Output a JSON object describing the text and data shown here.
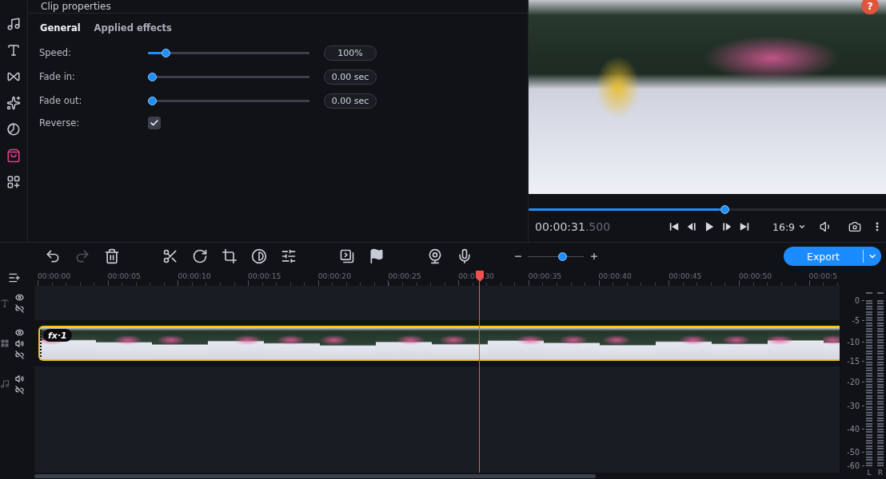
{
  "sidebar": {
    "items": [
      {
        "kind": "music",
        "selected": false
      },
      {
        "kind": "titles",
        "selected": false
      },
      {
        "kind": "transitions",
        "selected": false
      },
      {
        "kind": "effects",
        "selected": false
      },
      {
        "kind": "stickers",
        "selected": false
      },
      {
        "kind": "store",
        "selected": true
      },
      {
        "kind": "more",
        "selected": false
      }
    ]
  },
  "properties": {
    "title": "Clip properties",
    "tabs": [
      {
        "label": "General",
        "selected": true
      },
      {
        "label": "Applied effects",
        "selected": false
      }
    ],
    "rows": [
      {
        "kind": "slider",
        "label": "Speed:",
        "level": 0.09,
        "value": "100%"
      },
      {
        "kind": "slider",
        "label": "Fade in:",
        "level": 0,
        "value": "0.00 sec"
      },
      {
        "kind": "slider",
        "label": "Fade out:",
        "level": 0,
        "value": "0.00 sec"
      },
      {
        "kind": "checkbox",
        "label": "Reverse:",
        "checked": true
      }
    ]
  },
  "preview": {
    "help": "?",
    "progress": {
      "level": 0.55
    },
    "timecode": "00:00:31",
    "timecode_fraction": ".500",
    "aspect_ratio": "16:9"
  },
  "toolbar": {
    "groups": [
      [
        {
          "kind": "undo",
          "disabled": false
        },
        {
          "kind": "redo",
          "disabled": true
        },
        {
          "kind": "delete",
          "disabled": false
        }
      ],
      [
        {
          "kind": "cut",
          "disabled": false
        },
        {
          "kind": "rotate",
          "disabled": false
        },
        {
          "kind": "crop",
          "disabled": false
        },
        {
          "kind": "color",
          "disabled": false
        },
        {
          "kind": "adjust",
          "disabled": false
        }
      ],
      [
        {
          "kind": "overlay",
          "disabled": false
        },
        {
          "kind": "marker",
          "disabled": false
        }
      ],
      [
        {
          "kind": "webcam",
          "disabled": false
        },
        {
          "kind": "voice",
          "disabled": false
        }
      ]
    ],
    "zoom": {
      "level": 0.64
    },
    "export": {
      "label": "Export"
    }
  },
  "timeline": {
    "ruler": [
      [
        "00:00:00"
      ],
      [
        "00:00:05"
      ],
      [
        "00:00:10"
      ],
      [
        "00:00:15"
      ],
      [
        "00:00:20"
      ],
      [
        "00:00:25"
      ],
      [
        "00:0",
        "30"
      ],
      [
        "00:00:35"
      ],
      [
        "00:00:40"
      ],
      [
        "00:00:45"
      ],
      [
        "00:00:50"
      ],
      [
        "00:00:5"
      ]
    ],
    "playhead": {
      "level": 0.553
    },
    "tracks": [
      {
        "kind": "text"
      },
      {
        "kind": "video",
        "clip": {
          "badge": "fx·1"
        }
      },
      {
        "kind": "audio"
      }
    ]
  },
  "meter": {
    "scale": [
      "0",
      "-5",
      "-10",
      "-15",
      "-20",
      "-30",
      "-40",
      "-50",
      "-60"
    ],
    "channels": [
      "L",
      "R"
    ]
  }
}
